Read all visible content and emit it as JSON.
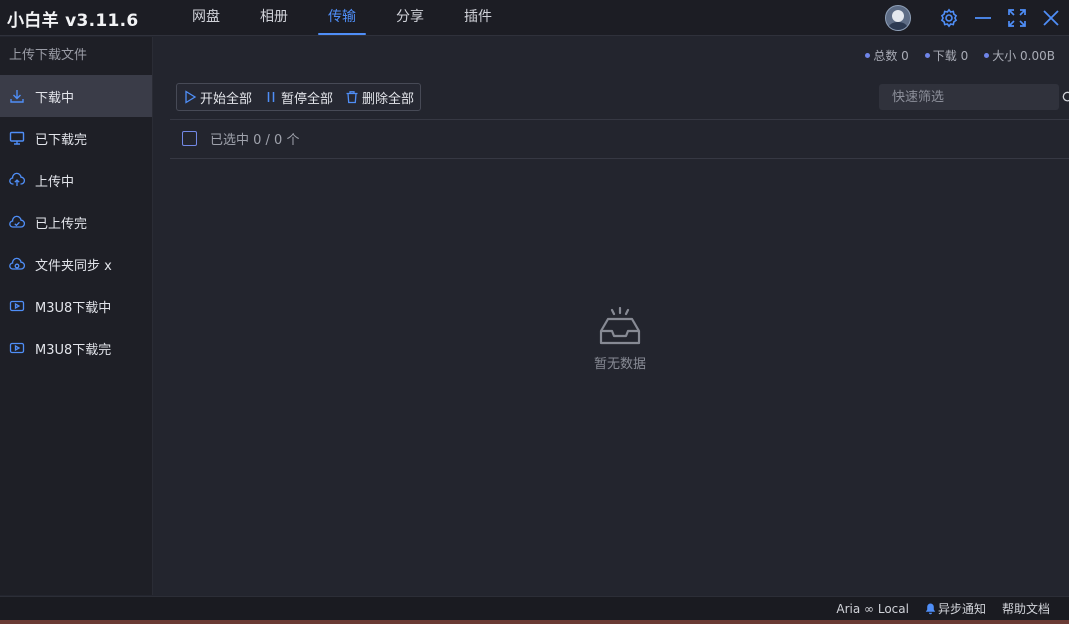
{
  "app": {
    "title": "小白羊 v3.11.6"
  },
  "nav": {
    "tabs": [
      {
        "label": "网盘",
        "active": false
      },
      {
        "label": "相册",
        "active": false
      },
      {
        "label": "传输",
        "active": true
      },
      {
        "label": "分享",
        "active": false
      },
      {
        "label": "插件",
        "active": false
      }
    ]
  },
  "window_controls": [
    "avatar",
    "gear-icon",
    "minimize-icon",
    "maximize-icon",
    "close-icon"
  ],
  "sidebar": {
    "title": "上传下载文件",
    "items": [
      {
        "label": "下载中",
        "icon": "download-icon",
        "active": true
      },
      {
        "label": "已下载完",
        "icon": "monitor-icon",
        "active": false
      },
      {
        "label": "上传中",
        "icon": "cloud-upload-icon",
        "active": false
      },
      {
        "label": "已上传完",
        "icon": "cloud-check-icon",
        "active": false
      },
      {
        "label": "文件夹同步 x",
        "icon": "cloud-sync-icon",
        "active": false
      },
      {
        "label": "M3U8下载中",
        "icon": "video-icon",
        "active": false
      },
      {
        "label": "M3U8下载完",
        "icon": "video-icon",
        "active": false
      }
    ]
  },
  "stats": {
    "total": "总数 0",
    "download": "下载 0",
    "size": "大小 0.00B"
  },
  "toolbar": {
    "start_all": "开始全部",
    "pause_all": "暂停全部",
    "delete_all": "删除全部"
  },
  "filter": {
    "placeholder": "快速筛选"
  },
  "selection": {
    "text": "已选中 0 / 0 个"
  },
  "empty": {
    "text": "暂无数据"
  },
  "statusbar": {
    "aria": "Aria ∞ Local",
    "notify": "异步通知",
    "help": "帮助文档"
  },
  "colors": {
    "accent": "#4f8ef7",
    "background": "#23252e",
    "sidebar": "#1e1f26",
    "active_item": "#3a3c48"
  }
}
